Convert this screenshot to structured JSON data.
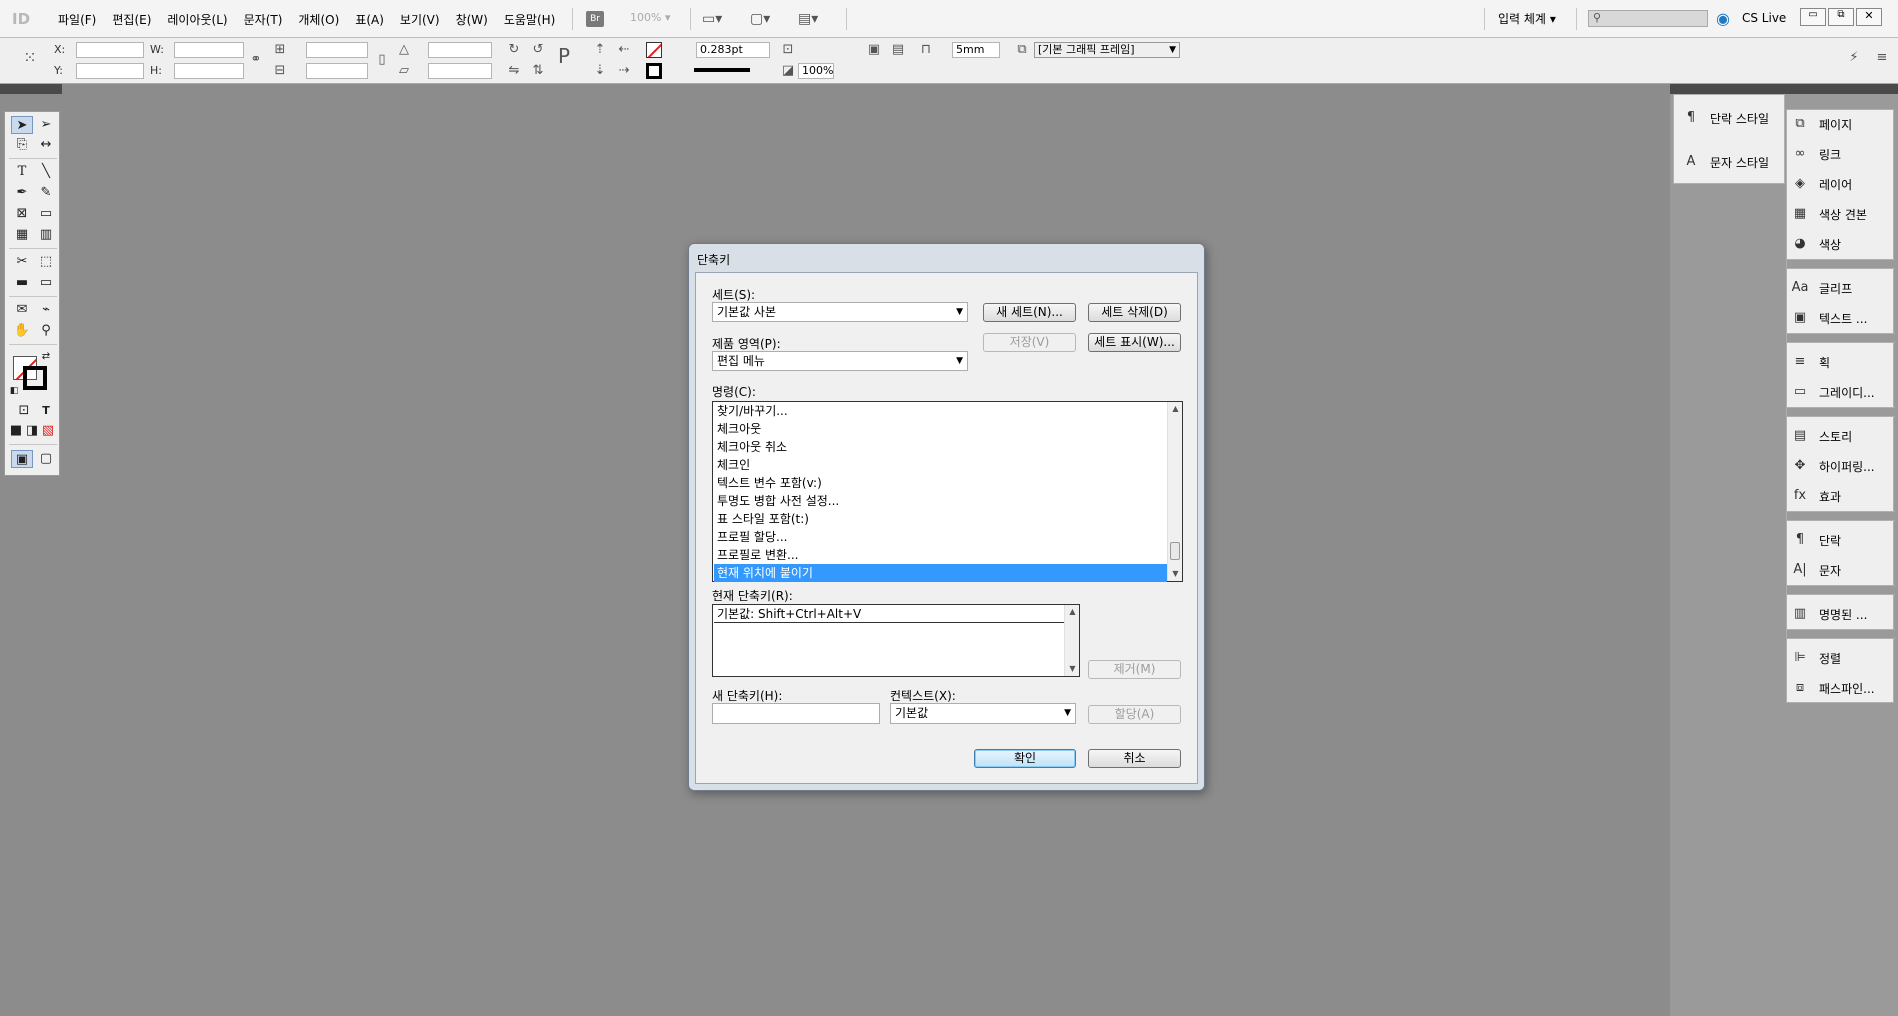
{
  "app": {
    "logo": "ID"
  },
  "menu": [
    "파일(F)",
    "편집(E)",
    "레이아웃(L)",
    "문자(T)",
    "개체(O)",
    "표(A)",
    "보기(V)",
    "창(W)",
    "도움말(H)"
  ],
  "menubar_tools": {
    "bridge": "Br",
    "zoom": "100%"
  },
  "workspace": {
    "label": "입력 체계",
    "search_placeholder": "",
    "cs_live": "CS Live"
  },
  "control": {
    "x_label": "X:",
    "y_label": "Y:",
    "w_label": "W:",
    "h_label": "H:",
    "stroke_weight": "0.283pt",
    "scale_percent": "100%",
    "gap": "5mm",
    "object_style": "[기본 그래픽 프레임]"
  },
  "right_panels_a": [
    {
      "icon": "paragraph-style-icon",
      "label": "단락 스타일"
    },
    {
      "icon": "character-style-icon",
      "label": "문자 스타일"
    }
  ],
  "right_panels_b": [
    {
      "icon": "pages-icon",
      "glyph": "⧉",
      "label": "페이지"
    },
    {
      "icon": "links-icon",
      "glyph": "∞",
      "label": "링크"
    },
    {
      "icon": "layers-icon",
      "glyph": "◈",
      "label": "레이어"
    },
    {
      "icon": "swatches-icon",
      "glyph": "▦",
      "label": "색상 견본"
    },
    {
      "icon": "color-icon",
      "glyph": "◕",
      "label": "색상"
    },
    {
      "icon": "glyphs-icon",
      "glyph": "Aa",
      "label": "글리프"
    },
    {
      "icon": "text-wrap-icon",
      "glyph": "▣",
      "label": "텍스트 ..."
    },
    {
      "icon": "stroke-icon",
      "glyph": "≡",
      "label": "획"
    },
    {
      "icon": "gradient-icon",
      "glyph": "▭",
      "label": "그레이디..."
    },
    {
      "icon": "story-icon",
      "glyph": "▤",
      "label": "스토리"
    },
    {
      "icon": "hyperlinks-icon",
      "glyph": "✥",
      "label": "하이퍼링..."
    },
    {
      "icon": "effects-icon",
      "glyph": "fx",
      "label": "효과"
    },
    {
      "icon": "paragraph-icon",
      "glyph": "¶",
      "label": "단락"
    },
    {
      "icon": "character-icon",
      "glyph": "A|",
      "label": "문자"
    },
    {
      "icon": "named-grids-icon",
      "glyph": "▥",
      "label": "명명된 ..."
    },
    {
      "icon": "align-icon",
      "glyph": "⊫",
      "label": "정렬"
    },
    {
      "icon": "pathfinder-icon",
      "glyph": "⧈",
      "label": "패스파인..."
    }
  ],
  "dialog": {
    "title": "단축키",
    "set_label": "세트(S):",
    "set_value": "기본값 사본",
    "new_set_button": "새 세트(N)...",
    "delete_set_button": "세트 삭제(D)",
    "product_area_label": "제품 영역(P):",
    "product_area_value": "편집 메뉴",
    "save_button": "저장(V)",
    "show_set_button": "세트 표시(W)...",
    "commands_label": "명령(C):",
    "commands": [
      "찾기/바꾸기...",
      "체크아웃",
      "체크아웃 취소",
      "체크인",
      "텍스트 변수 포함(v:)",
      "투명도 병합 사전 설정...",
      "표 스타일 포함(t:)",
      "프로필 할당...",
      "프로필로 변환...",
      "현재 위치에 붙이기"
    ],
    "selected_command": "현재 위치에 붙이기",
    "current_shortcuts_label": "현재 단축키(R):",
    "current_shortcuts": [
      "기본값: Shift+Ctrl+Alt+V"
    ],
    "remove_button": "제거(M)",
    "new_shortcut_label": "새 단축키(H):",
    "new_shortcut_value": "",
    "context_label": "컨텍스트(X):",
    "context_value": "기본값",
    "assign_button": "할당(A)",
    "ok_button": "확인",
    "cancel_button": "취소"
  }
}
